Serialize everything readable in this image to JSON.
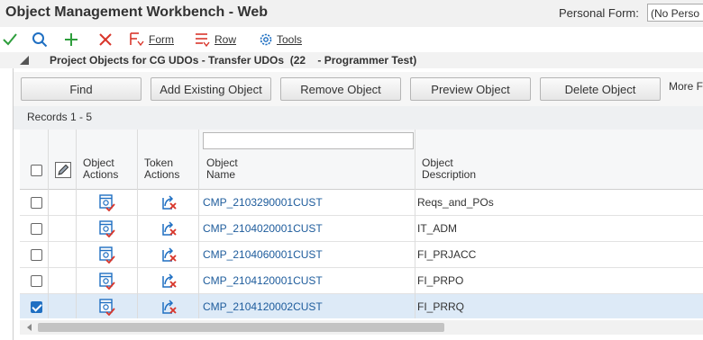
{
  "window": {
    "title": "Object Management Workbench - Web",
    "personal_form_label": "Personal Form:",
    "personal_form_value": "(No Perso"
  },
  "toolbar": {
    "ok_icon": "check-icon",
    "find_icon": "search-icon",
    "add_icon": "plus-icon",
    "delete_icon": "close-icon",
    "form_label": "Form",
    "row_label": "Row",
    "tools_label": "Tools"
  },
  "section": {
    "title": "Project Objects for CG UDOs - Transfer UDOs  (22    - Programmer Test)"
  },
  "buttons": {
    "find": "Find",
    "add_existing": "Add Existing Object",
    "remove": "Remove Object",
    "preview": "Preview Object",
    "delete": "Delete Object",
    "more": "More F"
  },
  "records": "Records 1 - 5",
  "grid": {
    "columns": {
      "object_actions": [
        "Object",
        "Actions"
      ],
      "token_actions": [
        "Token",
        "Actions"
      ],
      "object_name": [
        "Object",
        "Name"
      ],
      "object_description": [
        "Object",
        "Description"
      ]
    },
    "rows": [
      {
        "name": "CMP_2103290001CUST",
        "description": "Reqs_and_POs",
        "checked": false
      },
      {
        "name": "CMP_2104020001CUST",
        "description": "IT_ADM",
        "checked": false
      },
      {
        "name": "CMP_2104060001CUST",
        "description": "FI_PRJACC",
        "checked": false
      },
      {
        "name": "CMP_2104120001CUST",
        "description": "FI_PRPO",
        "checked": false
      },
      {
        "name": "CMP_2104120002CUST",
        "description": "FI_PRRQ",
        "checked": true
      }
    ]
  },
  "colors": {
    "accent": "#1f6fc2",
    "link": "#1e5c9c",
    "ok_green": "#2e9e3c",
    "cancel_red": "#d9362b",
    "selected_row": "#ddeaf7"
  }
}
